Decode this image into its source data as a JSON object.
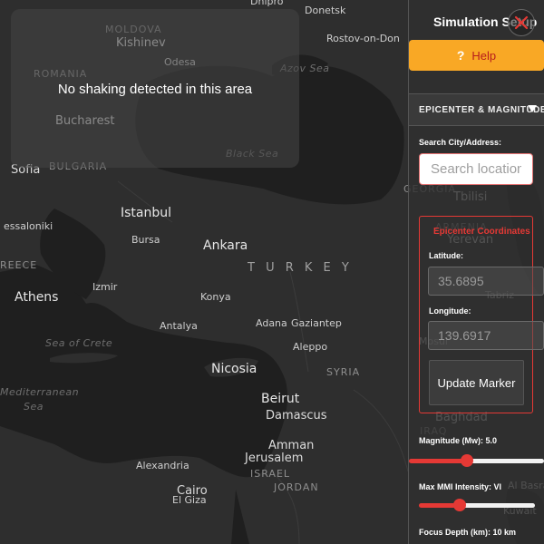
{
  "map": {
    "toast_message": "No shaking detected in this area",
    "labels": [
      {
        "id": "dnipro",
        "text": "Dnipro",
        "cls": "city-sm"
      },
      {
        "id": "donetsk",
        "text": "Donetsk",
        "cls": "city-sm"
      },
      {
        "id": "moldova",
        "text": "MOLDOVA",
        "cls": "country"
      },
      {
        "id": "kishinev",
        "text": "Kishinev",
        "cls": "city-md"
      },
      {
        "id": "rostov",
        "text": "Rostov-on-Don",
        "cls": "city-sm"
      },
      {
        "id": "odesa",
        "text": "Odesa",
        "cls": "city-sm"
      },
      {
        "id": "romania",
        "text": "ROMANIA",
        "cls": "country"
      },
      {
        "id": "azov",
        "text": "Azov Sea",
        "cls": "sea"
      },
      {
        "id": "bucharest",
        "text": "Bucharest",
        "cls": "city-md"
      },
      {
        "id": "blacksea",
        "text": "Black Sea",
        "cls": "sea"
      },
      {
        "id": "sofia",
        "text": "Sofia",
        "cls": "city-md"
      },
      {
        "id": "bulgaria",
        "text": "BULGARIA",
        "cls": "country"
      },
      {
        "id": "georgia",
        "text": "GEORGIA",
        "cls": "country"
      },
      {
        "id": "tbilisi",
        "text": "Tbilisi",
        "cls": "city-md"
      },
      {
        "id": "thessaloniki",
        "text": "essaloniki",
        "cls": "city-sm"
      },
      {
        "id": "istanbul",
        "text": "Istanbul",
        "cls": "city-lg"
      },
      {
        "id": "armenia",
        "text": "ARMENIA",
        "cls": "country"
      },
      {
        "id": "yerevan",
        "text": "Yerevan",
        "cls": "city-md"
      },
      {
        "id": "bursa",
        "text": "Bursa",
        "cls": "city-sm"
      },
      {
        "id": "ankara",
        "text": "Ankara",
        "cls": "city-lg"
      },
      {
        "id": "turkey",
        "text": "T U R K E Y",
        "cls": "country-lg"
      },
      {
        "id": "greece",
        "text": "REECE",
        "cls": "country"
      },
      {
        "id": "izmir",
        "text": "Izmir",
        "cls": "city-sm"
      },
      {
        "id": "athens",
        "text": "Athens",
        "cls": "city-lg"
      },
      {
        "id": "konya",
        "text": "Konya",
        "cls": "city-sm"
      },
      {
        "id": "tabriz",
        "text": "Tabriz",
        "cls": "city-sm"
      },
      {
        "id": "antalya",
        "text": "Antalya",
        "cls": "city-sm"
      },
      {
        "id": "adana",
        "text": "Adana",
        "cls": "city-sm"
      },
      {
        "id": "gaziantep",
        "text": "Gaziantep",
        "cls": "city-sm"
      },
      {
        "id": "seaofcrete",
        "text": "Sea of Crete",
        "cls": "sea"
      },
      {
        "id": "mosul",
        "text": "Mosul",
        "cls": "city-sm"
      },
      {
        "id": "aleppo",
        "text": "Aleppo",
        "cls": "city-sm"
      },
      {
        "id": "nicosia",
        "text": "Nicosia",
        "cls": "city-lg"
      },
      {
        "id": "syria",
        "text": "SYRIA",
        "cls": "country"
      },
      {
        "id": "mediterranean",
        "text": "Mediterranean",
        "cls": "sea"
      },
      {
        "id": "sea",
        "text": "Sea",
        "cls": "sea"
      },
      {
        "id": "beirut",
        "text": "Beirut",
        "cls": "city-lg"
      },
      {
        "id": "damascus",
        "text": "Damascus",
        "cls": "city-md"
      },
      {
        "id": "baghdad",
        "text": "Baghdad",
        "cls": "city-md"
      },
      {
        "id": "iraq",
        "text": "IRAQ",
        "cls": "country"
      },
      {
        "id": "amman",
        "text": "Amman",
        "cls": "city-md"
      },
      {
        "id": "alexandria",
        "text": "Alexandria",
        "cls": "city-sm"
      },
      {
        "id": "jerusalem",
        "text": "Jerusalem",
        "cls": "city-md"
      },
      {
        "id": "israel",
        "text": "ISRAEL",
        "cls": "country"
      },
      {
        "id": "jordan",
        "text": "JORDAN",
        "cls": "country"
      },
      {
        "id": "albasra",
        "text": "Al Basra",
        "cls": "city-sm"
      },
      {
        "id": "cairo",
        "text": "Cairo",
        "cls": "city-md"
      },
      {
        "id": "elgiza",
        "text": "El Giza",
        "cls": "city-sm"
      },
      {
        "id": "kuwait",
        "text": "Kuwait",
        "cls": "city-sm"
      }
    ]
  },
  "sidebar": {
    "title": "Simulation Setup",
    "close_icon": "close-x-icon",
    "help_label": "Help",
    "help_icon": "?",
    "section_title": "EPICENTER & MAGNITUDE",
    "search_label": "Search City/Address:",
    "search_placeholder": "Search location",
    "coords_title": "Epicenter Coordinates",
    "latitude_label": "Latitude:",
    "latitude_value": "35.6895",
    "longitude_label": "Longitude:",
    "longitude_value": "139.6917",
    "update_button": "Update Marker",
    "magnitude_label": "Magnitude (Mw): 5.0",
    "magnitude_level": 0.42,
    "mmi_label": "Max MMI Intensity: VI",
    "mmi_level": 0.33,
    "depth_label": "Focus Depth (km): 10 km",
    "colors": {
      "accent": "#e53935",
      "help_bg": "#f9a825"
    }
  }
}
